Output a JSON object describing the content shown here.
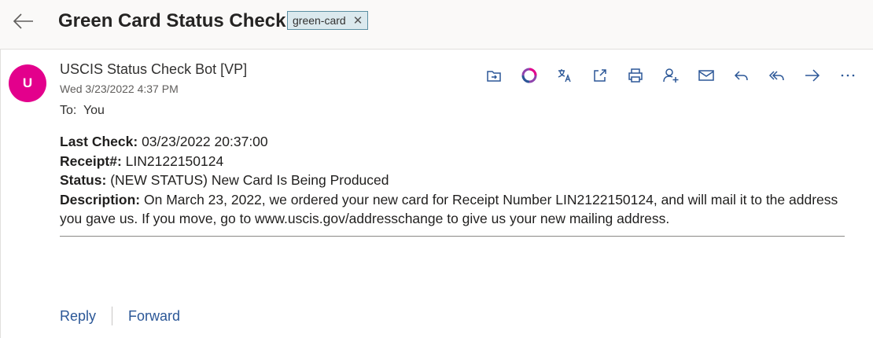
{
  "header": {
    "subject": "Green Card Status Check",
    "tag": "green-card"
  },
  "message": {
    "avatar_initial": "U",
    "avatar_color": "#e3008c",
    "sender": "USCIS Status Check Bot [VP]",
    "datetime": "Wed 3/23/2022 4:37 PM",
    "to_label": "To:",
    "to_value": "You",
    "body": {
      "last_check_label": "Last Check:",
      "last_check_value": "03/23/2022 20:37:00",
      "receipt_label": "Receipt#:",
      "receipt_value": "LIN2122150124",
      "status_label": "Status:",
      "status_value": "(NEW STATUS) New Card Is Being Produced",
      "description_label": "Description:",
      "description_value": "On March 23, 2022, we ordered your new card for Receipt Number LIN2122150124, and will mail it to the address you gave us. If you move, go to www.uscis.gov/addresschange to give us your new mailing address."
    }
  },
  "toolbar": {
    "icons": [
      "move-to-folder-icon",
      "loop-icon",
      "translate-icon",
      "open-in-new-window-icon",
      "print-icon",
      "add-contact-icon",
      "mail-icon",
      "reply-icon",
      "reply-all-icon",
      "forward-icon",
      "more-icon"
    ]
  },
  "footer": {
    "reply_label": "Reply",
    "forward_label": "Forward"
  },
  "colors": {
    "accent_link": "#2b5797",
    "tag_bg": "#dbe9ee",
    "icon": "#2b5797"
  }
}
